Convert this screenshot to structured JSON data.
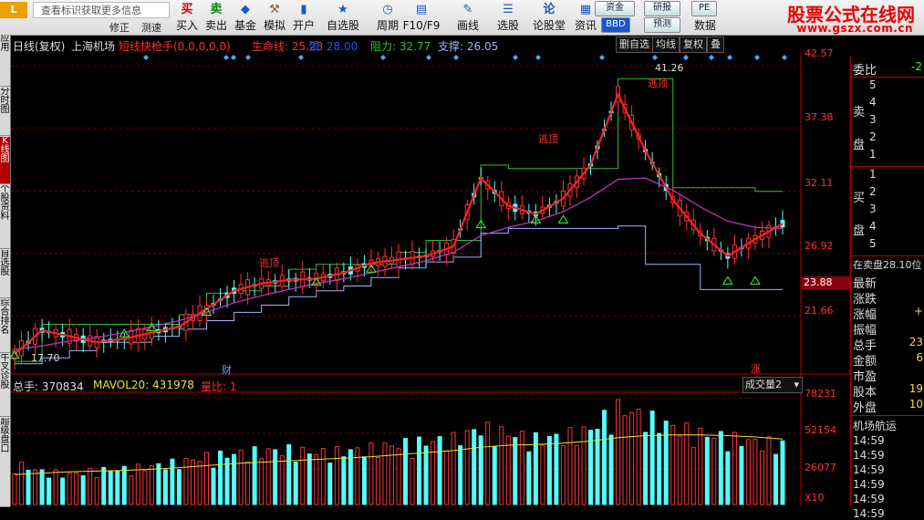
{
  "toolbar": {
    "hint": "查看标识获取更多信息",
    "sub_left": "修正",
    "sub_right": "测速",
    "buttons": [
      {
        "label": "买入",
        "icon": "买",
        "icon_color": "#d00000"
      },
      {
        "label": "卖出",
        "icon": "卖",
        "icon_color": "#008a00"
      },
      {
        "label": "基金",
        "icon": "◆",
        "icon_color": "#1a56c8"
      },
      {
        "label": "模拟",
        "icon": "⚒",
        "icon_color": "#a0522d"
      },
      {
        "label": "开户",
        "icon": "▮",
        "icon_color": "#1a56c8"
      },
      {
        "label": "自选股",
        "icon": "★",
        "icon_color": "#1a56c8"
      },
      {
        "label": "周期",
        "icon": "◷",
        "icon_color": "#1a56c8"
      },
      {
        "label": "F10/F9",
        "icon": "▤",
        "icon_color": "#1a56c8"
      },
      {
        "label": "画线",
        "icon": "✎",
        "icon_color": "#1a56c8"
      },
      {
        "label": "选股",
        "icon": "☰",
        "icon_color": "#1a56c8"
      },
      {
        "label": "论股堂",
        "icon": "论",
        "icon_color": "#1a56c8"
      },
      {
        "label": "资讯",
        "icon": "▦",
        "icon_color": "#1a56c8"
      },
      {
        "label": "数据",
        "icon": "▤",
        "icon_color": "#1a56c8"
      }
    ],
    "small_buttons": {
      "funds": "资金",
      "bbd": "BBD",
      "research": "研报",
      "forecast": "预测",
      "pe": "PE"
    },
    "brand": "股票公式在线网",
    "brand_url": "www.gszx.com.cn"
  },
  "left_tabs": [
    {
      "label": "应用",
      "active": false
    },
    {
      "label": "分时图",
      "active": false
    },
    {
      "label": "K线图",
      "active": true
    },
    {
      "label": "个股资料",
      "active": false
    },
    {
      "label": "自选股",
      "active": false
    },
    {
      "label": "综合排名",
      "active": false
    },
    {
      "label": "牛叉诊股",
      "active": false
    },
    {
      "label": "超级盘口",
      "active": false
    }
  ],
  "chart_header": {
    "period": "日线(复权)",
    "stock": "上海机场",
    "indicator": "短线快枪手(0,0,0,0,0)",
    "lifeline_label": "生命线: 25.23",
    "ma_label": "颈: 28.00",
    "resistance_label": "阻力: 32.77",
    "support_label": "支撑: 26.05",
    "right_buttons": [
      "删自选",
      "均线",
      "复权",
      "叠"
    ]
  },
  "price_axis": {
    "labels": [
      "42.57",
      "37.38",
      "32.11",
      "26.92",
      "21.66"
    ],
    "current": "23.88"
  },
  "annotations": {
    "top_high": "41.26",
    "low": "17.70",
    "sell_signal": "逃顶",
    "cai": "财",
    "zhang": "涨"
  },
  "volume_header": {
    "total": "总手: 370834",
    "mavol": "MAVOL20: 431978",
    "ratio": "量比: 1",
    "selector": "成交量2"
  },
  "volume_axis": {
    "labels": [
      "78231",
      "52154",
      "26077"
    ],
    "unit": "X10"
  },
  "right_panel": {
    "weibi": "委比",
    "weibi_val": "-2",
    "sell_label": "卖盘",
    "buy_label": "买盘",
    "sell_levels": [
      "5",
      "4",
      "3",
      "2",
      "1"
    ],
    "buy_levels": [
      "1",
      "2",
      "3",
      "4",
      "5"
    ],
    "in_sell": "在卖盘28.10位",
    "fields": [
      "最新",
      "涨跌",
      "涨幅",
      "振幅",
      "总手",
      "金额",
      "市盈",
      "股本",
      "外盘"
    ],
    "field_vals": [
      "",
      "",
      "+",
      "",
      "23",
      "6",
      "",
      "19",
      "10"
    ],
    "news_title": "机场航运",
    "ticks": [
      "14:59",
      "14:59",
      "14:59",
      "14:59",
      "14:59",
      "14:59"
    ]
  },
  "colors": {
    "up": "#ff3232",
    "down": "#54ffff",
    "lifeline": "#ff2020",
    "ma": "#c030c0",
    "resistance": "#30c030",
    "support": "#a0b4ff",
    "grid": "#6e0000"
  },
  "chart_data": {
    "type": "candlestick",
    "ylim": [
      17.0,
      43.5
    ],
    "support": [
      17.7,
      18.2,
      18.8,
      19.5,
      19.5,
      20.0,
      20.6,
      21.3,
      22.0,
      22.6,
      23.3,
      23.8,
      24.2,
      24.9,
      25.7,
      26.2,
      26.6,
      28.6,
      29.0,
      29.0,
      29.0,
      29.0,
      29.2,
      26.0,
      26.0,
      23.9,
      23.9,
      23.9,
      23.9
    ],
    "resistance": [
      17.9,
      21.0,
      21.0,
      21.0,
      21.0,
      21.0,
      21.8,
      23.6,
      23.8,
      24.2,
      25.6,
      26.0,
      26.0,
      26.0,
      27.0,
      28.0,
      28.0,
      34.3,
      34.0,
      34.0,
      34.0,
      34.0,
      41.5,
      41.5,
      32.4,
      32.4,
      32.4,
      32.1,
      32.1
    ],
    "lifeline": [
      18.5,
      20.5,
      20.0,
      19.5,
      19.8,
      20.3,
      20.8,
      22.3,
      23.8,
      24.4,
      24.7,
      24.8,
      25.3,
      26.1,
      26.4,
      26.7,
      27.5,
      33.2,
      30.9,
      30.2,
      31.5,
      34.3,
      40.2,
      35.5,
      31.4,
      28.6,
      26.7,
      28.1,
      29.4
    ],
    "ma": [
      18.9,
      19.2,
      19.6,
      19.9,
      20.3,
      20.8,
      21.3,
      22.0,
      22.8,
      23.4,
      23.9,
      24.4,
      24.8,
      25.3,
      25.8,
      26.3,
      27.0,
      28.4,
      29.1,
      29.6,
      30.4,
      31.6,
      33.1,
      33.2,
      32.2,
      30.8,
      29.6,
      29.1,
      29.0
    ],
    "volume": [
      30000,
      24000,
      22000,
      25000,
      26000,
      28000,
      31000,
      35000,
      37000,
      39000,
      40000,
      38000,
      39000,
      41000,
      44000,
      46000,
      48000,
      56000,
      52000,
      48000,
      50000,
      55000,
      72000,
      64000,
      57000,
      52000,
      49000,
      46000,
      44000
    ],
    "mavol": [
      22000,
      23000,
      24000,
      24500,
      25000,
      25800,
      27000,
      28500,
      30000,
      31000,
      32000,
      33000,
      34000,
      35000,
      36500,
      38000,
      39500,
      42000,
      43500,
      44000,
      45000,
      46500,
      49000,
      50500,
      51000,
      51000,
      50500,
      49500,
      48000
    ]
  }
}
